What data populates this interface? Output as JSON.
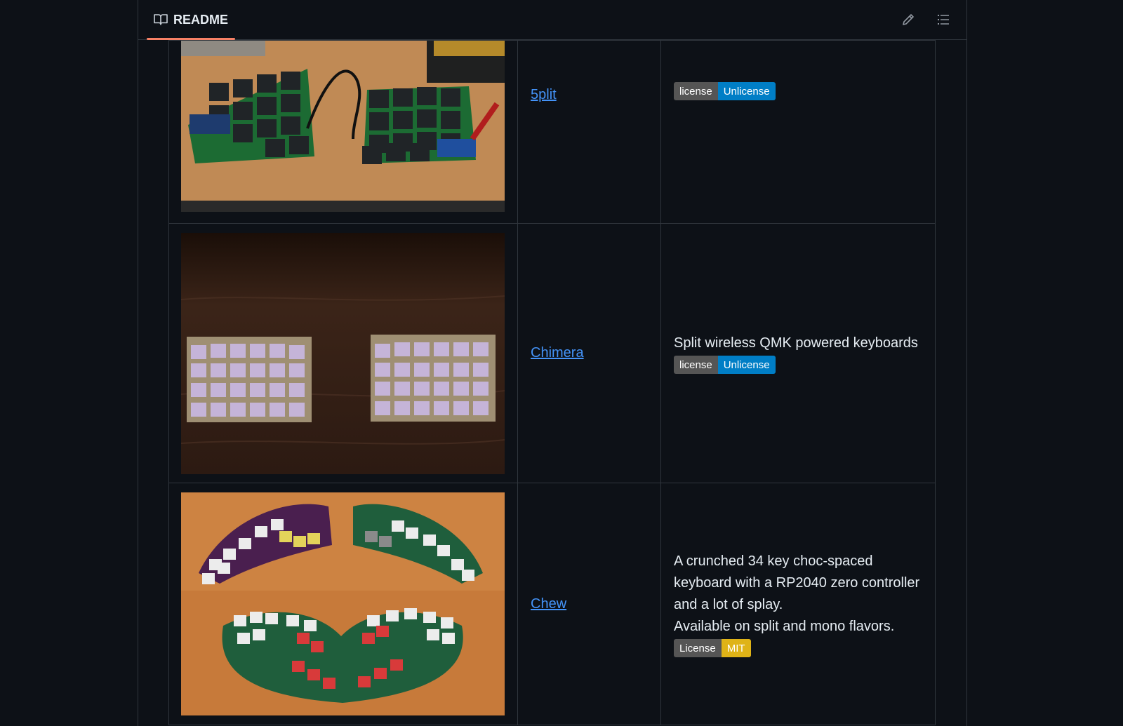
{
  "readme": {
    "title": "README",
    "icon": "book-icon"
  },
  "toolbar": {
    "edit_icon": "pencil-icon",
    "toc_icon": "list-icon"
  },
  "projects": [
    {
      "name": "5plit",
      "description": "",
      "badge": {
        "label": "license",
        "value": "Unlicense",
        "color": "#007ec6"
      }
    },
    {
      "name": "Chimera",
      "description": "Split wireless QMK powered keyboards",
      "badge": {
        "label": "license",
        "value": "Unlicense",
        "color": "#007ec6"
      }
    },
    {
      "name": "Chew",
      "description_lines": [
        "A crunched 34 key choc-spaced",
        "keyboard with a RP2040 zero controller",
        "and a lot of splay.",
        "Available on split and mono flavors."
      ],
      "badge": {
        "label": "License",
        "value": "MIT",
        "color": "#dfb317"
      }
    }
  ]
}
